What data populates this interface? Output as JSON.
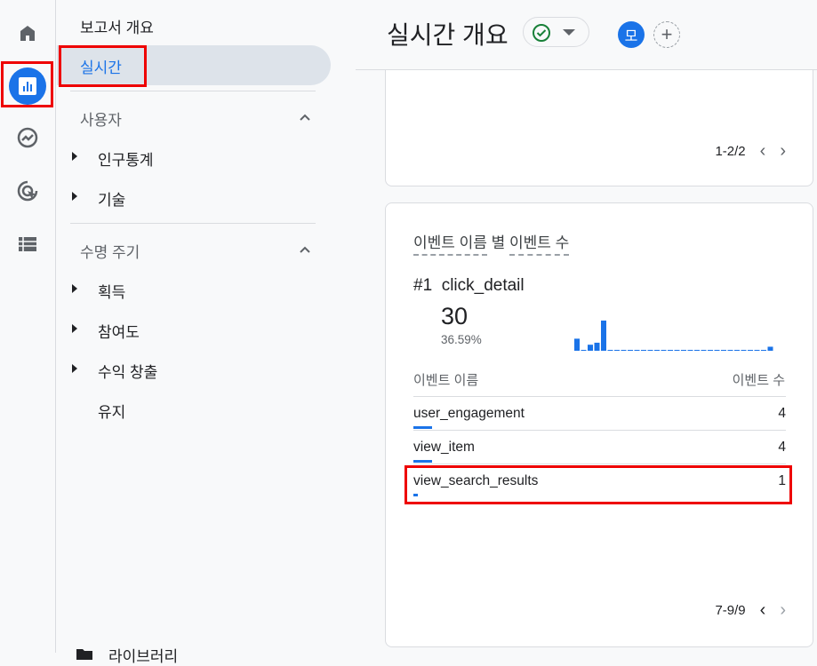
{
  "nav": {
    "overview": "보고서 개요",
    "realtime": "실시간",
    "user_section": "사용자",
    "user_items": [
      "인구통계",
      "기술"
    ],
    "lifecycle_section": "수명 주기",
    "lifecycle_items": [
      "획득",
      "참여도",
      "수익 창출"
    ],
    "retention": "유지",
    "library": "라이브러리"
  },
  "header": {
    "title": "실시간 개요",
    "avatar": "모",
    "add": "+"
  },
  "card1": {
    "pager": "1-2/2"
  },
  "card2": {
    "title_part1": "이벤트 이름",
    "title_mid": " 별 ",
    "title_part2": "이벤트 수",
    "top_label": "#1  click_detail",
    "top_value": "30",
    "top_percent": "36.59%",
    "col_name": "이벤트 이름",
    "col_count": "이벤트 수",
    "rows": [
      {
        "name": "user_engagement",
        "count": "4",
        "fraction": 0.049
      },
      {
        "name": "view_item",
        "count": "4",
        "fraction": 0.049
      },
      {
        "name": "view_search_results",
        "count": "1",
        "fraction": 0.012
      }
    ],
    "pager": "7-9/9"
  },
  "chart_data": {
    "type": "bar",
    "title": "click_detail per minute",
    "values": [
      6,
      0,
      3,
      4,
      15,
      0,
      0,
      0,
      0,
      0,
      0,
      0,
      0,
      0,
      0,
      0,
      0,
      0,
      0,
      0,
      0,
      0,
      0,
      0,
      0,
      0,
      0,
      0,
      0,
      2
    ]
  },
  "colors": {
    "accent": "#1a73e8",
    "highlight": "#ee0000",
    "check": "#188038"
  }
}
